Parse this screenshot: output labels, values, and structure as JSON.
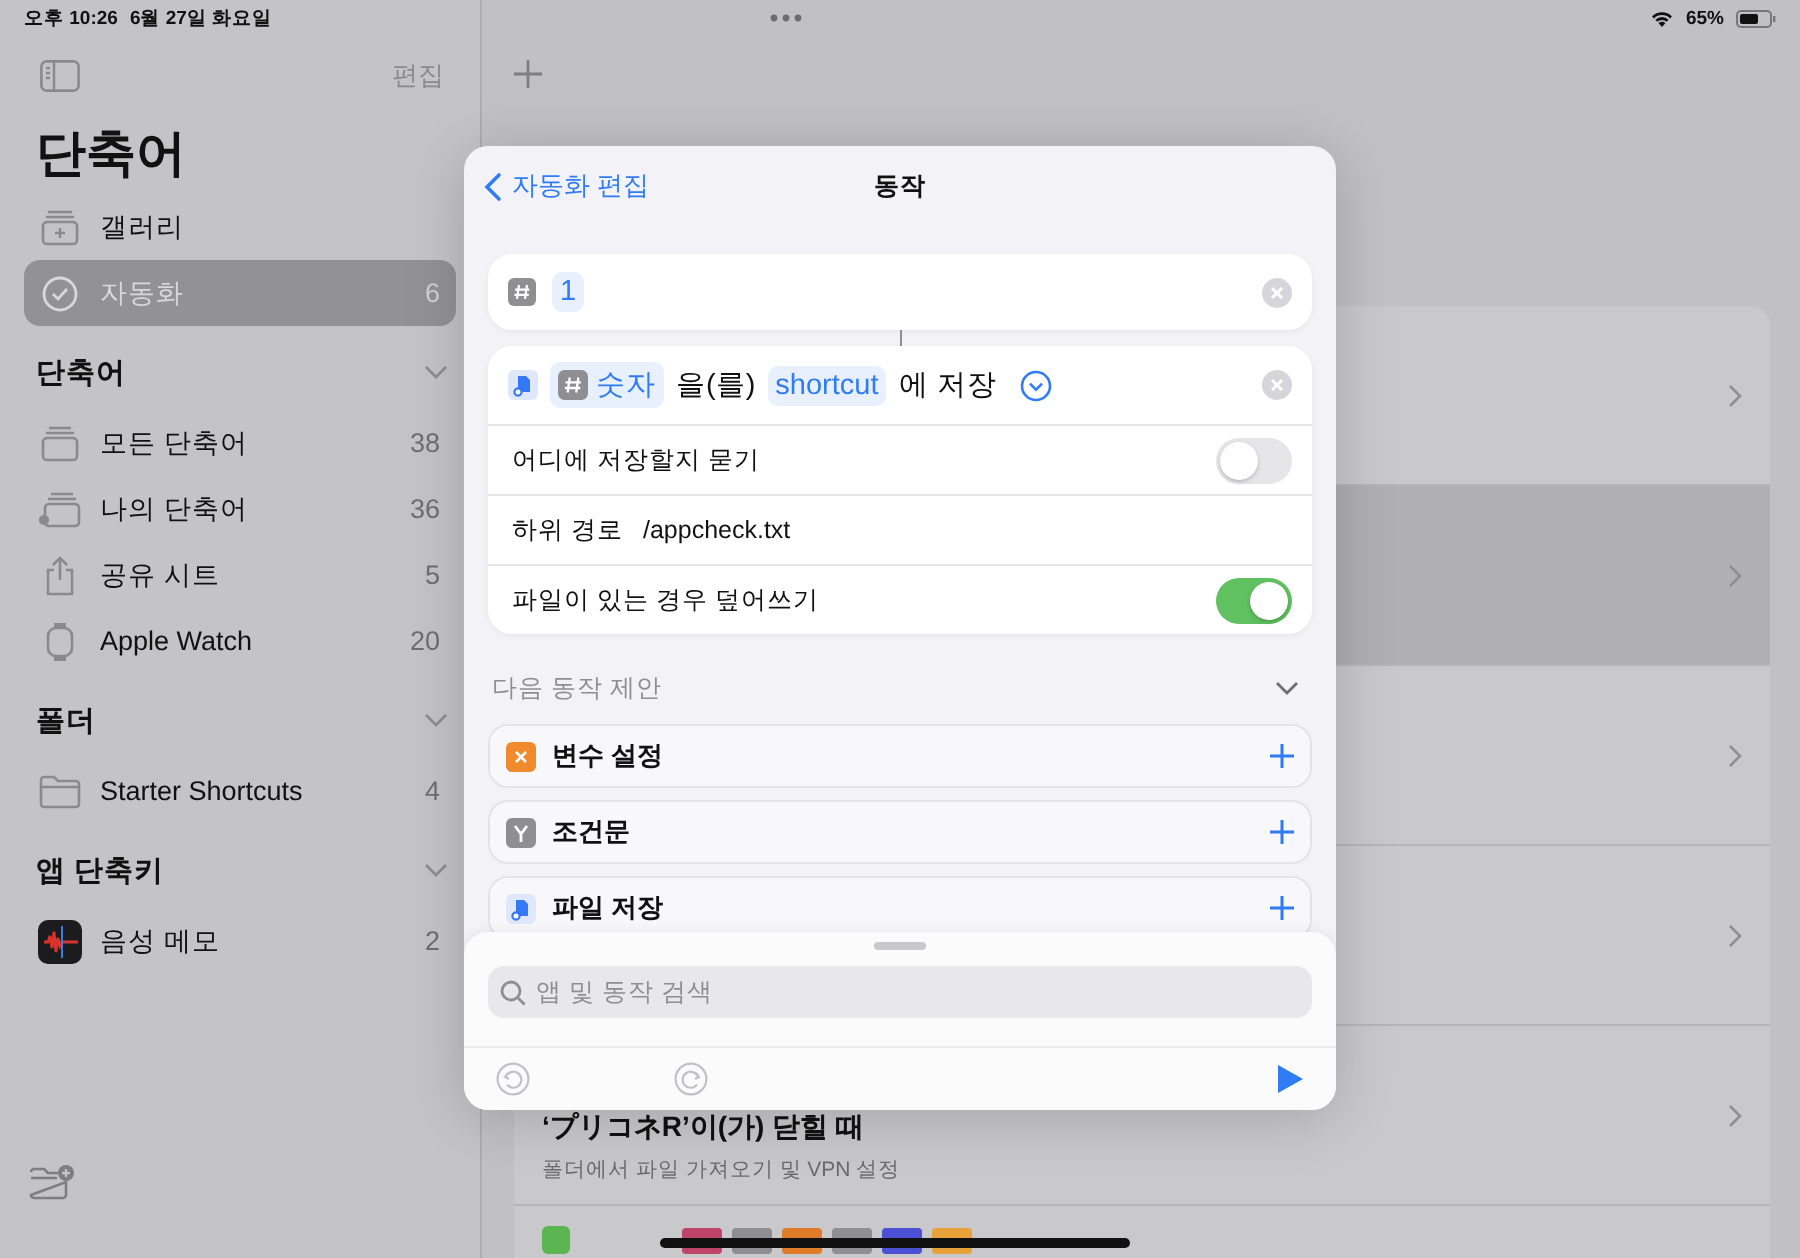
{
  "status_bar": {
    "time": "오후 10:26",
    "date": "6월 27일 화요일",
    "battery": "65%"
  },
  "sidebar": {
    "edit": "편집",
    "title": "단축어",
    "top_items": [
      {
        "kind": "gallery",
        "label": "갤러리",
        "selected": false
      },
      {
        "kind": "automation",
        "label": "자동화",
        "count": "6",
        "selected": true
      }
    ],
    "sections": [
      {
        "title": "단축어",
        "expanded": true,
        "items": [
          {
            "kind": "stack",
            "label": "모든 단축어",
            "count": "38"
          },
          {
            "kind": "person-stack",
            "label": "나의 단축어",
            "count": "36"
          },
          {
            "kind": "share",
            "label": "공유 시트",
            "count": "5"
          },
          {
            "kind": "watch",
            "label": "Apple Watch",
            "count": "20"
          }
        ]
      },
      {
        "title": "폴더",
        "expanded": true,
        "items": [
          {
            "kind": "folder",
            "label": "Starter Shortcuts",
            "count": "4"
          }
        ]
      },
      {
        "title": "앱 단축키",
        "expanded": true,
        "items": [
          {
            "kind": "voice-memo",
            "label": "음성 메모",
            "count": "2"
          }
        ]
      }
    ]
  },
  "main": {
    "automations": [
      {
        "selected": false
      },
      {
        "selected": true
      },
      {
        "selected": false
      },
      {
        "selected": false
      },
      {
        "selected": false,
        "title": "‘プリコネR’이(가) 닫힐 때",
        "subtitle": "폴더에서 파일 가져오기 및 VPN 설정"
      },
      {
        "selected": false,
        "kind": "app-icons"
      }
    ]
  },
  "modal": {
    "back": "자동화 편집",
    "title": "동작",
    "number_action": {
      "value": "1"
    },
    "save_action": {
      "parts": [
        {
          "kind": "variable",
          "text": "숫자"
        },
        {
          "kind": "text",
          "text": "을(를)"
        },
        {
          "kind": "token",
          "text": "shortcut"
        },
        {
          "kind": "text",
          "text": "에 저장"
        }
      ],
      "options": [
        {
          "kind": "toggle",
          "label": "어디에 저장할지 묻기",
          "on": false
        },
        {
          "kind": "value",
          "label": "하위 경로",
          "value": "/appcheck.txt"
        },
        {
          "kind": "toggle",
          "label": "파일이 있는 경우 덮어쓰기",
          "on": true
        }
      ]
    },
    "suggestions": {
      "title": "다음 동작 제안",
      "expanded": true,
      "items": [
        {
          "kind": "variable",
          "label": "변수 설정"
        },
        {
          "kind": "condition",
          "label": "조건문"
        },
        {
          "kind": "file",
          "label": "파일 저장"
        }
      ]
    },
    "search": {
      "placeholder": "앱 및 동작 검색"
    }
  }
}
